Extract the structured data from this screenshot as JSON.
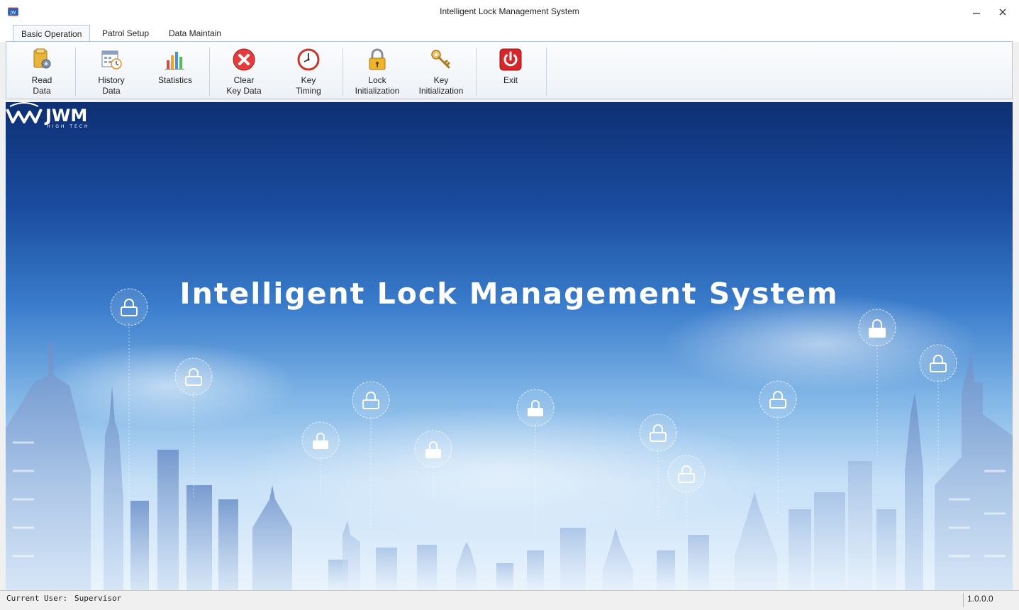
{
  "window": {
    "title": "Intelligent Lock Management System"
  },
  "tabs": [
    {
      "label": "Basic Operation",
      "active": true
    },
    {
      "label": "Patrol Setup",
      "active": false
    },
    {
      "label": "Data Maintain",
      "active": false
    }
  ],
  "ribbon": {
    "read_data": {
      "line1": "Read",
      "line2": "Data",
      "icon": "read-data-icon"
    },
    "history_data": {
      "line1": "History",
      "line2": "Data",
      "icon": "calendar-clock-icon"
    },
    "statistics": {
      "line1": "Statistics",
      "line2": "",
      "icon": "bar-chart-icon"
    },
    "clear_key_data": {
      "line1": "Clear",
      "line2": "Key Data",
      "icon": "red-x-icon"
    },
    "key_timing": {
      "line1": "Key",
      "line2": "Timing",
      "icon": "clock-icon"
    },
    "lock_init": {
      "line1": "Lock",
      "line2": "Initialization",
      "icon": "padlock-icon"
    },
    "key_init": {
      "line1": "Key",
      "line2": "Initialization",
      "icon": "key-icon"
    },
    "exit": {
      "line1": "Exit",
      "line2": "",
      "icon": "power-icon"
    }
  },
  "banner": {
    "title": "Intelligent Lock Management System",
    "logo_text": "JWM",
    "logo_subtext": "HIGH TECH"
  },
  "status": {
    "user_label": "Current User:",
    "user_value": "Supervisor",
    "version": "1.0.0.0"
  },
  "colors": {
    "banner_top": "#0d2f73",
    "banner_bottom": "#eaf4fd",
    "exit_red": "#d9262b",
    "clear_red": "#e43b3b"
  }
}
